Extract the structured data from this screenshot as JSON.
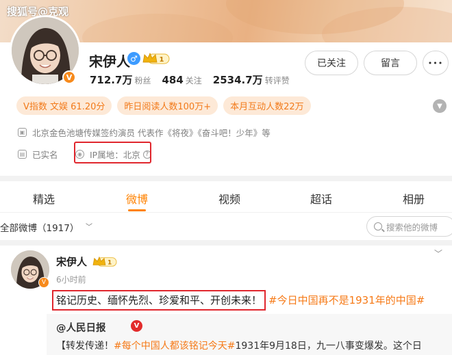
{
  "watermark": "搜狐号@克观",
  "profile": {
    "name": "宋伊人",
    "level": "1",
    "verified_badge": "V",
    "gender_symbol": "♂",
    "stats": [
      {
        "value": "712.7万",
        "label": "粉丝"
      },
      {
        "value": "484",
        "label": "关注"
      },
      {
        "value": "2534.7万",
        "label": "转评赞"
      }
    ],
    "buttons": {
      "follow": "已关注",
      "message": "留言",
      "more": "•••"
    },
    "tags": [
      "V指数 文娱 61.20分",
      "昨日阅读人数100万+",
      "本月互动人数22万"
    ],
    "company": "北京金色池塘传媒签约演员 代表作《将夜》《奋斗吧！少年》等",
    "realname": "已实名",
    "ip_location": "IP属地：北京",
    "ip_help": "?"
  },
  "tabs": [
    {
      "label": "精选",
      "active": false
    },
    {
      "label": "微博",
      "active": true
    },
    {
      "label": "视频",
      "active": false
    },
    {
      "label": "超话",
      "active": false
    },
    {
      "label": "相册",
      "active": false
    }
  ],
  "filter": {
    "label": "全部微博（1917）",
    "search_placeholder": "搜索他的微博"
  },
  "post": {
    "author": "宋伊人",
    "level": "1",
    "time": "6小时前",
    "text_highlight": "铭记历史、缅怀先烈、珍爱和平、开创未来！",
    "topic": "#今日中国再不是1931年的中国#",
    "repost": {
      "author": "@人民日报",
      "prefix": "【转发传递！",
      "topic": "#每个中国人都该铭记今天#",
      "text": "1931年9月18日，九一八事变爆发。这个日"
    }
  },
  "colors": {
    "accent": "#ff8200",
    "highlight_box": "#e0262d",
    "topic": "#f67a17",
    "tag_bg": "#fde9d7"
  }
}
